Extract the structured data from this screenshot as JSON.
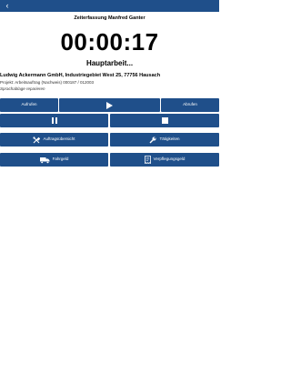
{
  "app": {
    "back_icon": "chevron-left-icon",
    "title": "Zeiterfassung Manfred Ganter"
  },
  "timer": {
    "value": "00:00:17",
    "status": "Hauptarbeit..."
  },
  "job": {
    "customer": "Ludwig Ackermann GmbH, Industriegebiet West 25, 77756 Hausach",
    "project": "Projekt: Arbeitsauftrag (Nachweis) 000187 / 012003",
    "voice_link": "Sprachablage reparieren"
  },
  "controls": {
    "aufrufen_label": "Aufrufen",
    "abrufen_label": "Abrufen",
    "play_icon": "play-icon",
    "pause_icon": "pause-icon",
    "stop_icon": "stop-icon"
  },
  "actions": {
    "auftrag_label": "Auftragsübersicht",
    "auftrag_icon": "tools-icon",
    "taetig_label": "Tätigkeiten",
    "taetig_icon": "wrench-icon",
    "fahrgeld_label": "Fahrgeld",
    "fahrgeld_icon": "truck-icon",
    "verpfleg_label": "Verpflegungsgeld",
    "verpfleg_icon": "receipt-icon"
  },
  "colors": {
    "primary": "#1f4f8a",
    "background": "#ffffff"
  }
}
